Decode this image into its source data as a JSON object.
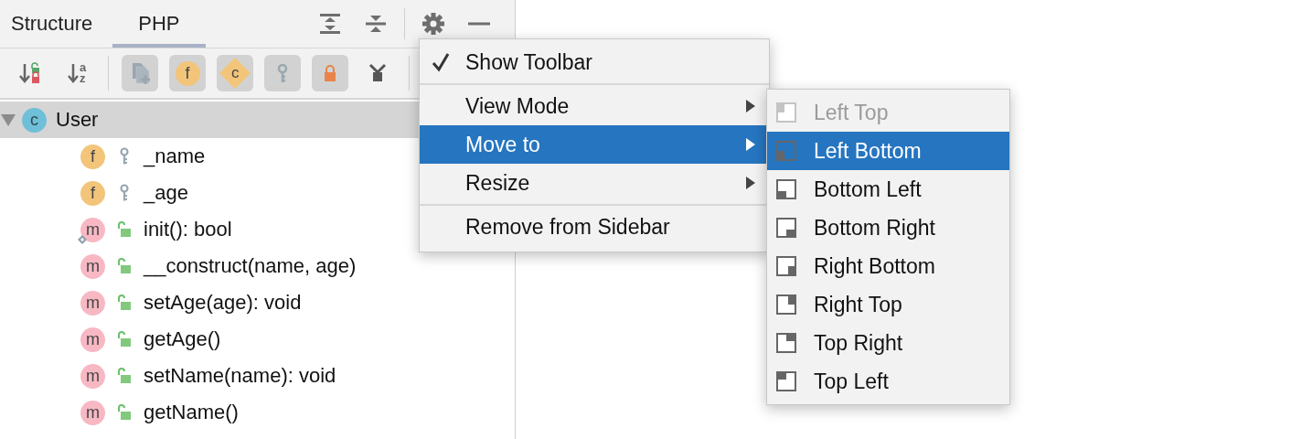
{
  "tabs": [
    {
      "label": "Structure",
      "selected": false
    },
    {
      "label": "PHP",
      "selected": true
    }
  ],
  "header_actions": [
    {
      "kind": "expand-all"
    },
    {
      "kind": "collapse-all"
    },
    {
      "kind": "separator"
    },
    {
      "kind": "settings"
    },
    {
      "kind": "minimize"
    }
  ],
  "toolbar": [
    {
      "kind": "sort-visibility",
      "on": false
    },
    {
      "kind": "sort-alpha",
      "on": false,
      "glyph_top": "a",
      "glyph_bottom": "z"
    },
    {
      "kind": "separator"
    },
    {
      "kind": "inherited",
      "on": true
    },
    {
      "kind": "field",
      "on": true,
      "glyph": "f"
    },
    {
      "kind": "constant",
      "on": true,
      "glyph": "c"
    },
    {
      "kind": "key",
      "on": true
    },
    {
      "kind": "lock",
      "on": true
    },
    {
      "kind": "branch",
      "on": false
    },
    {
      "kind": "separator"
    }
  ],
  "tree": [
    {
      "label": "User",
      "kind": "class",
      "glyph": "c",
      "expanded": true,
      "selected": true,
      "children": [
        {
          "label": "_name",
          "kind": "field",
          "glyph": "f",
          "private": true,
          "overrides": false,
          "selected": false
        },
        {
          "label": "_age",
          "kind": "field",
          "glyph": "f",
          "private": true,
          "overrides": false,
          "selected": false
        },
        {
          "label": "init(): bool",
          "kind": "method",
          "glyph": "m",
          "private": false,
          "overrides": true,
          "selected": false
        },
        {
          "label": "__construct(name, age)",
          "kind": "method",
          "glyph": "m",
          "private": false,
          "overrides": false,
          "selected": false
        },
        {
          "label": "setAge(age): void",
          "kind": "method",
          "glyph": "m",
          "private": false,
          "overrides": false,
          "selected": false
        },
        {
          "label": "getAge()",
          "kind": "method",
          "glyph": "m",
          "private": false,
          "overrides": false,
          "selected": false
        },
        {
          "label": "setName(name): void",
          "kind": "method",
          "glyph": "m",
          "private": false,
          "overrides": false,
          "selected": false
        },
        {
          "label": "getName()",
          "kind": "method",
          "glyph": "m",
          "private": false,
          "overrides": false,
          "selected": false
        }
      ]
    }
  ],
  "menu": {
    "items": [
      {
        "kind": "item",
        "label": "Show Toolbar",
        "checked": true,
        "submenu": false,
        "selected": false
      },
      {
        "kind": "separator"
      },
      {
        "kind": "item",
        "label": "View Mode",
        "checked": false,
        "submenu": true,
        "selected": false
      },
      {
        "kind": "item",
        "label": "Move to",
        "checked": false,
        "submenu": true,
        "selected": true
      },
      {
        "kind": "item",
        "label": "Resize",
        "checked": false,
        "submenu": true,
        "selected": false
      },
      {
        "kind": "separator"
      },
      {
        "kind": "item",
        "label": "Remove from Sidebar",
        "checked": false,
        "submenu": false,
        "selected": false
      }
    ]
  },
  "submenu": {
    "items": [
      {
        "label": "Left Top",
        "kind": "left-top",
        "disabled": true,
        "selected": false
      },
      {
        "label": "Left Bottom",
        "kind": "left-bottom",
        "disabled": false,
        "selected": true
      },
      {
        "label": "Bottom Left",
        "kind": "bottom-left",
        "disabled": false,
        "selected": false
      },
      {
        "label": "Bottom Right",
        "kind": "bottom-right",
        "disabled": false,
        "selected": false
      },
      {
        "label": "Right Bottom",
        "kind": "right-bottom",
        "disabled": false,
        "selected": false
      },
      {
        "label": "Right Top",
        "kind": "right-top",
        "disabled": false,
        "selected": false
      },
      {
        "label": "Top Right",
        "kind": "top-right",
        "disabled": false,
        "selected": false
      },
      {
        "label": "Top Left",
        "kind": "top-left",
        "disabled": false,
        "selected": false
      }
    ]
  }
}
